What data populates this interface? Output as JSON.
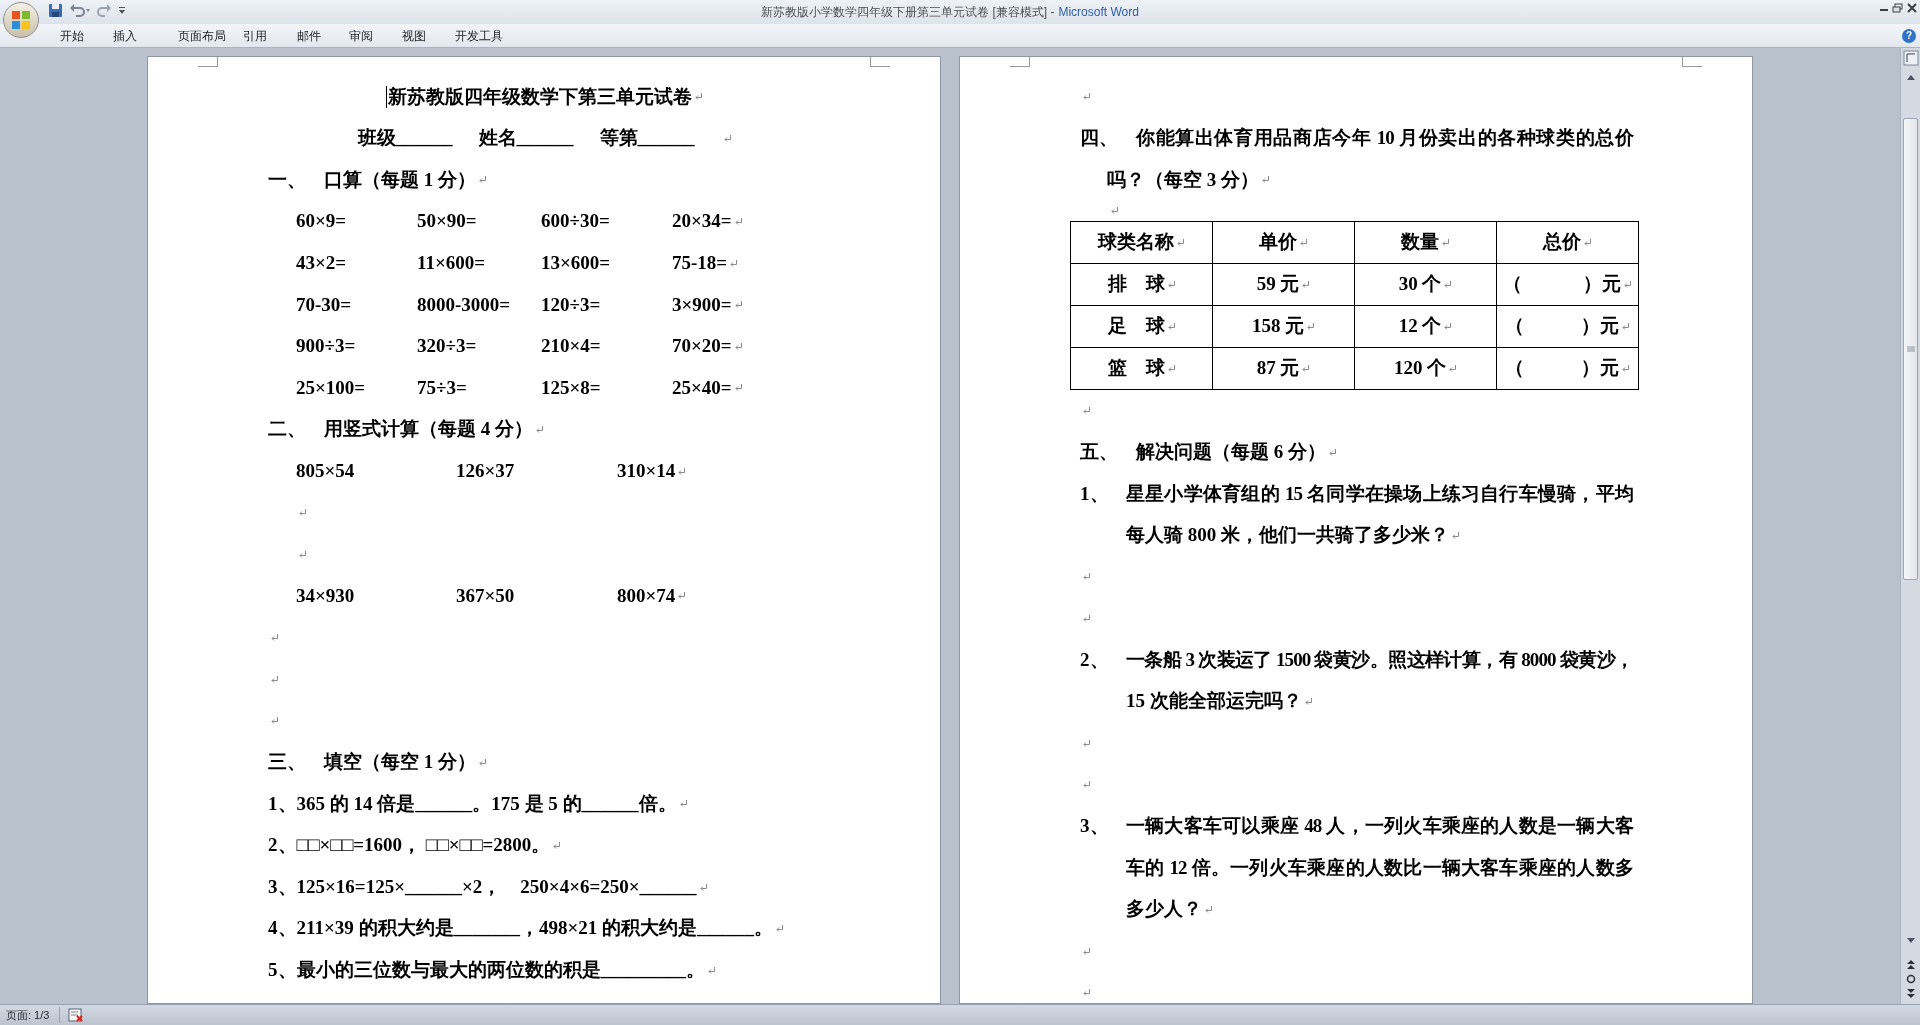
{
  "window": {
    "document_title": "新苏教版小学数学四年级下册第三单元试卷 [兼容模式] -",
    "app_name": "Microsoft Word",
    "help": "?"
  },
  "ribbon_tabs": [
    "开始",
    "插入",
    "页面布局",
    "引用",
    "邮件",
    "审阅",
    "视图",
    "开发工具"
  ],
  "pages": [
    {
      "paragraphs": [
        {
          "kind": "title",
          "text": "新苏教版四年级数学下第三单元试卷"
        },
        {
          "kind": "fields",
          "cells": [
            "班级______",
            "姓名______",
            "等第______"
          ]
        },
        {
          "kind": "heading",
          "number": "一、",
          "text": "口算（每题 1 分）"
        },
        {
          "kind": "row",
          "cells": [
            "60×9=",
            "50×90=",
            "600÷30=",
            "20×34="
          ]
        },
        {
          "kind": "row",
          "cells": [
            "43×2=",
            "11×600=",
            "13×600=",
            "75-18="
          ]
        },
        {
          "kind": "row",
          "cells": [
            "70-30=",
            "8000-3000=",
            "120÷3=",
            "3×900="
          ]
        },
        {
          "kind": "row",
          "cells": [
            "900÷3=",
            "320÷3=",
            "210×4=",
            "70×20="
          ]
        },
        {
          "kind": "row",
          "cells": [
            "25×100=",
            "75÷3=",
            "125×8=",
            "25×40="
          ]
        },
        {
          "kind": "heading",
          "number": "二、",
          "text": "用竖式计算（每题 4 分）"
        },
        {
          "kind": "row",
          "cells": [
            "805×54",
            "126×37",
            "310×14"
          ]
        },
        {
          "kind": "indented_blank"
        },
        {
          "kind": "indented_blank"
        },
        {
          "kind": "row",
          "cells": [
            "34×930",
            "367×50",
            "800×74"
          ]
        },
        {
          "kind": "blank"
        },
        {
          "kind": "blank"
        },
        {
          "kind": "blank"
        },
        {
          "kind": "heading",
          "number": "三、",
          "text": "填空（每空 1 分）"
        },
        {
          "kind": "text",
          "text": "1、365 的 14 倍是______。175 是 5 的______倍。"
        },
        {
          "kind": "text",
          "text": "2、□□×□□=1600， □□×□□=2800。"
        },
        {
          "kind": "text",
          "text": "3、125×16=125×______×2，    250×4×6=250×______"
        },
        {
          "kind": "text",
          "text": "4、211×39 的积大约是_______，498×21 的积大约是______。"
        },
        {
          "kind": "text",
          "text": "5、最小的三位数与最大的两位数的积是_________。"
        }
      ]
    },
    {
      "paragraphs": [
        {
          "kind": "blank"
        },
        {
          "kind": "heading",
          "number": "四、",
          "lines": [
            "你能算出体育用品商店今年 10 月份卖出的各种球类的总价",
            "吗？（每空 3 分）"
          ]
        },
        {
          "kind": "indented_blank"
        },
        {
          "kind": "table",
          "rows": [
            [
              "球类名称",
              "单价",
              "数量",
              "总价"
            ],
            [
              "排　球",
              "59 元",
              "30 个",
              "（　　　 ）元"
            ],
            [
              "足　球",
              "158 元",
              "12 个",
              "（　　　）元"
            ],
            [
              "篮　球",
              "87 元",
              "120 个",
              "（　　　）元"
            ]
          ]
        },
        {
          "kind": "blank"
        },
        {
          "kind": "heading",
          "number": "五、",
          "text": "解决问题（每题 6 分）"
        },
        {
          "kind": "item",
          "number": "1、",
          "lines": [
            "星星小学体育组的 15 名同学在操场上练习自行车慢骑，平均",
            "每人骑 800 米，他们一共骑了多少米？"
          ]
        },
        {
          "kind": "blank"
        },
        {
          "kind": "blank"
        },
        {
          "kind": "item",
          "number": "2、",
          "lines": [
            "一条船 3 次装运了 1500 袋黄沙。照这样计算，有 8000 袋黄沙，",
            "15 次能全部运完吗？"
          ]
        },
        {
          "kind": "blank"
        },
        {
          "kind": "blank"
        },
        {
          "kind": "item",
          "number": "3、",
          "lines": [
            "一辆大客车可以乘座 48 人，一列火车乘座的人数是一辆大客",
            "车的 12 倍。一列火车乘座的人数比一辆大客车乘座的人数多",
            "多少人？"
          ]
        },
        {
          "kind": "blank"
        },
        {
          "kind": "blank"
        }
      ]
    }
  ],
  "status_bar": {
    "page": "页面: 1/3"
  }
}
